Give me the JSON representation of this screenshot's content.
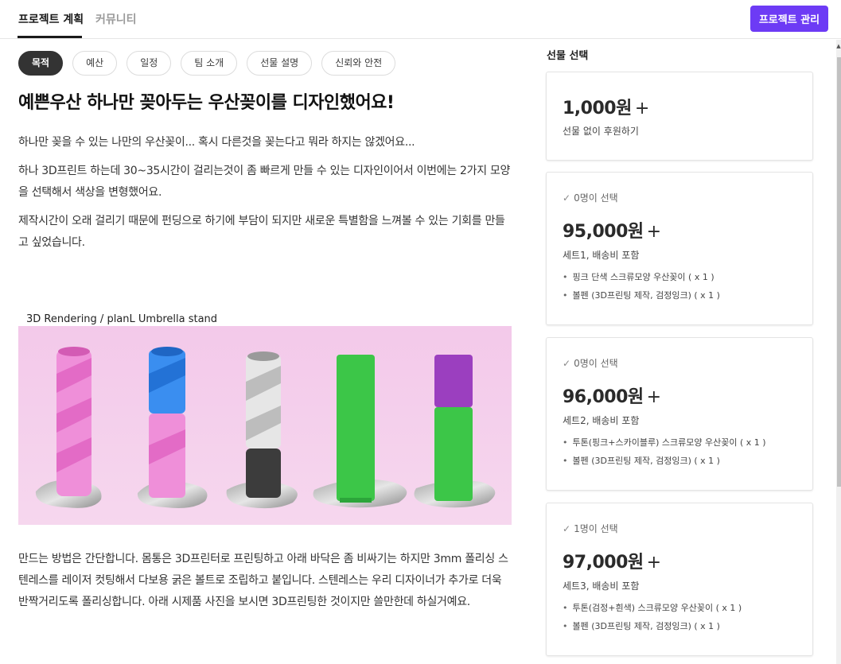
{
  "nav": {
    "tab_plan": "프로젝트 계획",
    "tab_community": "커뮤니티",
    "manage_button": "프로젝트 관리"
  },
  "chips": [
    "목적",
    "예산",
    "일정",
    "팀 소개",
    "선물 설명",
    "신뢰와 안전"
  ],
  "content": {
    "headline": "예쁜우산 하나만 꽂아두는 우산꽂이를 디자인했어요!",
    "para1": "하나만 꽂을 수 있는 나만의 우산꽂이... 혹시 다른것을 꽂는다고 뭐라 하지는 않겠어요...",
    "para2": "하나 3D프린트 하는데 30~35시간이 걸리는것이 좀 빠르게 만들 수 있는 디자인이어서 이번에는 2가지 모양을 선택해서 색상을 변형했어요.",
    "para3": "제작시간이 오래 걸리기 때문에 펀딩으로 하기에 부담이 되지만 새로운 특별함을 느껴볼 수 있는 기회를 만들고 싶었습니다.",
    "image_caption": "3D Rendering / planL Umbrella stand",
    "para4": "만드는 방법은 간단합니다.  몸통은 3D프린터로 프린팅하고 아래 바닥은 좀 비싸기는 하지만 3mm 폴리싱 스텐레스를 레이저 컷팅해서 다보용 굵은 볼트로 조립하고 붙입니다. 스텐레스는 우리 디자이너가 추가로 더욱 반짝거리도록 폴리싱합니다.  아래 시제품 사진을 보시면 3D프린팅한 것이지만 쓸만한데 하실거예요."
  },
  "sidebar": {
    "title": "선물 선택",
    "gifts": [
      {
        "price": "1,000원",
        "plus": "+",
        "desc": "선물 없이 후원하기"
      },
      {
        "selected": "0명이 선택",
        "price": "95,000원",
        "plus": "+",
        "desc": "세트1, 배송비 포함",
        "items": [
          "핑크 단색 스크류모양 우산꽂이 ( x 1 )",
          "볼펜 (3D프린팅 제작, 검정잉크) ( x 1 )"
        ]
      },
      {
        "selected": "0명이 선택",
        "price": "96,000원",
        "plus": "+",
        "desc": "세트2, 배송비 포함",
        "items": [
          "투톤(핑크+스카이블루) 스크류모양 우산꽂이  ( x 1 )",
          "볼펜 (3D프린팅 제작, 검정잉크) ( x 1 )"
        ]
      },
      {
        "selected": "1명이 선택",
        "price": "97,000원",
        "plus": "+",
        "desc": "세트3, 배송비 포함",
        "items": [
          "투톤(검정+흰색) 스크류모양 우산꽂이 ( x 1 )",
          "볼펜 (3D프린팅 제작, 검정잉크) ( x 1 )"
        ]
      }
    ]
  },
  "colors": {
    "accent": "#6d3bf5",
    "chip_active": "#333333",
    "image_bg": "#f4cfea"
  },
  "icons": {
    "check": "check-icon",
    "scroll_up": "arrow-up-icon"
  }
}
